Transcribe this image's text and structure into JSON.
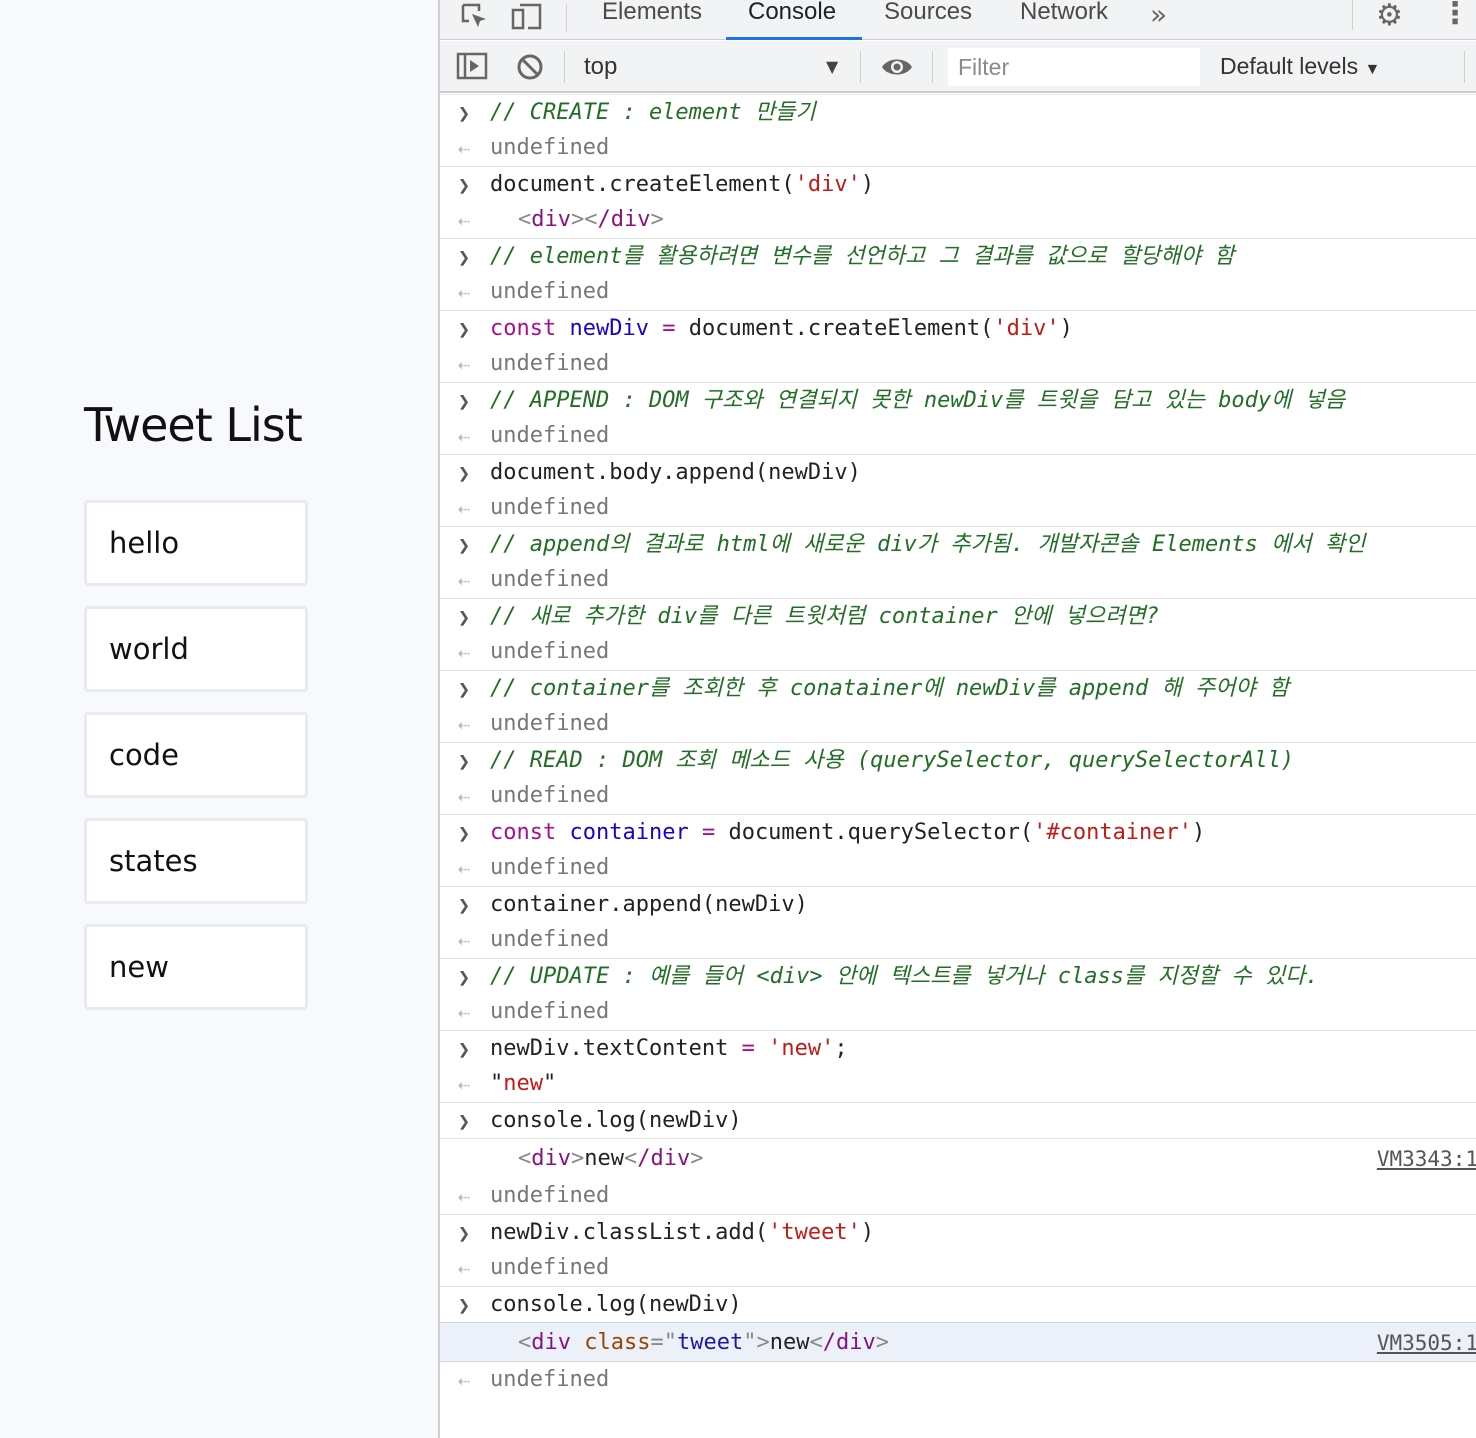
{
  "page": {
    "title": "Tweet List",
    "tweets": [
      "hello",
      "world",
      "code",
      "states",
      "new"
    ]
  },
  "devtools": {
    "tabs": [
      "Elements",
      "Console",
      "Sources",
      "Network"
    ],
    "active_tab": "Console",
    "more_tabs_icon": "chevron-double-right-icon",
    "toolbar": {
      "context": "top",
      "filter_placeholder": "Filter",
      "levels": "Default levels"
    }
  },
  "console": {
    "lines": [
      {
        "kind": "input",
        "text": "// CREATE : element 만들기"
      },
      {
        "kind": "output",
        "text": "undefined"
      },
      {
        "kind": "input",
        "text": "document.createElement('div')"
      },
      {
        "kind": "output",
        "text": "<div></div>"
      },
      {
        "kind": "input",
        "text": "// element를 활용하려면 변수를 선언하고 그 결과를 값으로 할당해야 함"
      },
      {
        "kind": "output",
        "text": "undefined"
      },
      {
        "kind": "input",
        "text": "const newDiv = document.createElement('div')"
      },
      {
        "kind": "output",
        "text": "undefined"
      },
      {
        "kind": "input",
        "text": "// APPEND : DOM 구조와 연결되지 못한 newDiv를 트윗을 담고 있는 body에 넣음"
      },
      {
        "kind": "output",
        "text": "undefined"
      },
      {
        "kind": "input",
        "text": "document.body.append(newDiv)"
      },
      {
        "kind": "output",
        "text": "undefined"
      },
      {
        "kind": "input",
        "text": "// append의 결과로 html에 새로운 div가 추가됨. 개발자콘솔 Elements 에서 확인"
      },
      {
        "kind": "output",
        "text": "undefined"
      },
      {
        "kind": "input",
        "text": "// 새로 추가한 div를 다른 트윗처럼 container 안에 넣으려면?"
      },
      {
        "kind": "output",
        "text": "undefined"
      },
      {
        "kind": "input",
        "text": "// container를 조회한 후 conatainer에 newDiv를 append 해 주어야 함"
      },
      {
        "kind": "output",
        "text": "undefined"
      },
      {
        "kind": "input",
        "text": "// READ : DOM 조회 메소드 사용 (querySelector, querySelectorAll)"
      },
      {
        "kind": "output",
        "text": "undefined"
      },
      {
        "kind": "input",
        "text": "const container = document.querySelector('#container')"
      },
      {
        "kind": "output",
        "text": "undefined"
      },
      {
        "kind": "input",
        "text": "container.append(newDiv)"
      },
      {
        "kind": "output",
        "text": "undefined"
      },
      {
        "kind": "input",
        "text": "// UPDATE : 예를 들어 <div> 안에 텍스트를 넣거나 class를 지정할 수 있다."
      },
      {
        "kind": "output",
        "text": "undefined"
      },
      {
        "kind": "input",
        "text": "newDiv.textContent = 'new';"
      },
      {
        "kind": "output",
        "text": "\"new\""
      },
      {
        "kind": "input",
        "text": "console.log(newDiv)"
      },
      {
        "kind": "log",
        "text": "<div>new</div>",
        "source": "VM3343:1"
      },
      {
        "kind": "output",
        "text": "undefined"
      },
      {
        "kind": "input",
        "text": "newDiv.classList.add('tweet')"
      },
      {
        "kind": "output",
        "text": "undefined"
      },
      {
        "kind": "input",
        "text": "console.log(newDiv)"
      },
      {
        "kind": "log",
        "text": "<div class=\"tweet\">new</div>",
        "source": "VM3505:1"
      },
      {
        "kind": "output",
        "text": "undefined"
      }
    ]
  }
}
